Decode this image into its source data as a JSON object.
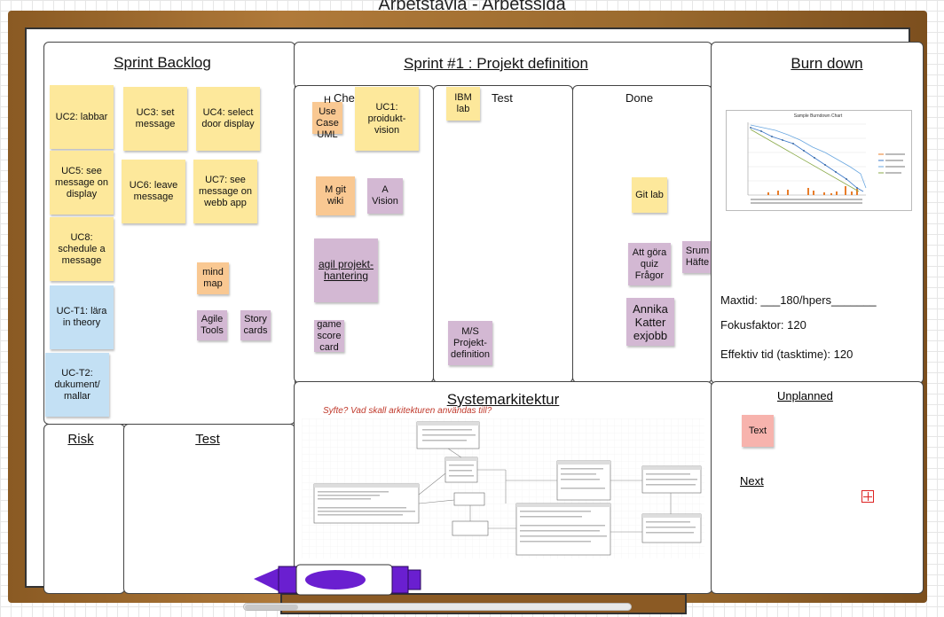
{
  "page": {
    "title": "Arbetstavla - Arbetssida"
  },
  "sprint_backlog": {
    "title": "Sprint Backlog",
    "stickies": [
      "UC2: labbar",
      "UC3:  set message",
      "UC4: select door display",
      "UC5: see message on display",
      "UC6:  leave message",
      "UC7: see message on webb app",
      "UC8: schedule a message",
      "mind map",
      "Agile Tools",
      "Story cards",
      "UC-T1: lära in theory",
      "UC-T2: dukument/ mallar"
    ]
  },
  "sprint": {
    "title": "Sprint #1 : Projekt definition",
    "columns": {
      "check": "Che",
      "test": "Test",
      "done": "Done"
    },
    "check_stickies": [
      "H Use Case UML",
      "UC1: proidukt-vision",
      "M git wiki",
      "A Vision",
      "agil projekt-hantering",
      "game score card"
    ],
    "test_stickies": [
      "IBM lab",
      "M/S Projekt-definition"
    ],
    "done_stickies": [
      "Git lab",
      "Att göra quiz Frågor",
      "Srum Häfte",
      "Annika Katter exjobb"
    ]
  },
  "burndown": {
    "title": "Burn down",
    "chart_title": "Sample Burndown Chart",
    "maxtid": "Maxtid: ___180/hpers_______",
    "fokusfaktor": "Fokusfaktor: 120",
    "effektiv_tid": "Effektiv tid (tasktime):  120"
  },
  "risk": {
    "title": "Risk"
  },
  "test_panel": {
    "title": "Test"
  },
  "system": {
    "title": "Systemarkitektur",
    "subtitle": "Syfte? Vad skall arkitekturen användas till?"
  },
  "unplanned": {
    "title": "Unplanned",
    "sticky": "Text",
    "next": "Next"
  },
  "colors": {
    "frame": "#9a6a2e",
    "sticky_yellow": "#fde89b",
    "sticky_orange": "#f9c892",
    "sticky_purple": "#d3b8d3",
    "sticky_blue": "#c3e0f4",
    "sticky_pink": "#f7b3ad",
    "marker": "#6a1fd0"
  },
  "icons": {
    "add": "plus-square-icon",
    "marker": "marker-icon"
  }
}
